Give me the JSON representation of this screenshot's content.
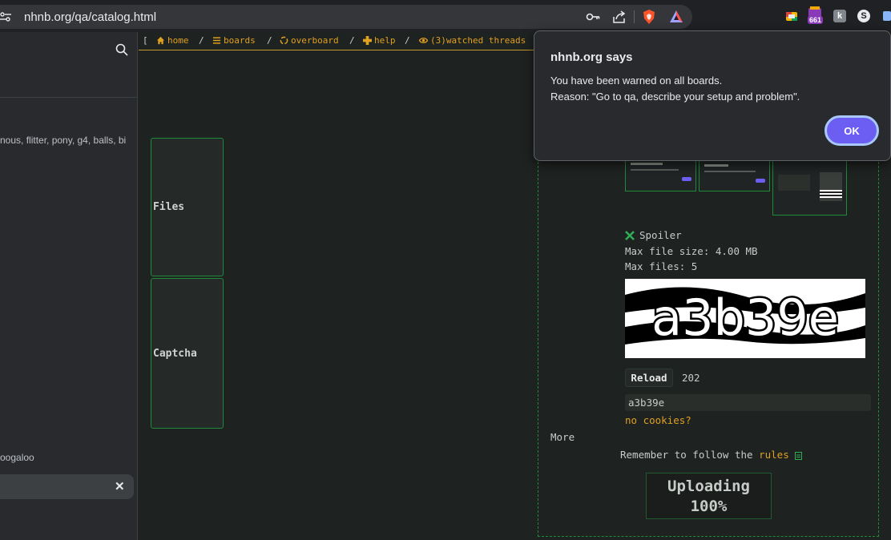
{
  "browser": {
    "url": "nhnb.org/qa/catalog.html",
    "extension_badge": "661",
    "icons": [
      "site-info-icon",
      "key-icon",
      "share-icon",
      "brave-shields-icon",
      "brave-rewards-icon",
      "ext-google-icon",
      "ext-badge-icon",
      "ext-k-icon",
      "ext-s-icon",
      "ext-partial-icon"
    ]
  },
  "side_panel": {
    "tags_text": "nous, flitter, pony, g4, balls, bi",
    "item_text": "oogaloo",
    "search_value": ""
  },
  "nav": {
    "open_bracket": "[",
    "home": "home",
    "boards": "boards",
    "overboard": "overboard",
    "help": "help",
    "watched": "(3)watched threads",
    "sep": "/"
  },
  "post_form": {
    "files_label": "Files",
    "spoiler_label": "Spoiler",
    "max_file_size": "Max file size: 4.00 MB",
    "max_files": "Max files: 5",
    "captcha_label": "Captcha",
    "captcha_text": "a3b39e",
    "reload_label": "Reload",
    "reload_timer": "202",
    "captcha_value": "a3b39e",
    "no_cookies": "no cookies?",
    "more": "More",
    "rules_prefix": "Remember to follow the ",
    "rules_link": "rules",
    "upload_line1": "Uploading",
    "upload_line2": "100%"
  },
  "dialog": {
    "title": "nhnb.org says",
    "line1": "You have been warned on all boards.",
    "line2": "Reason: \"Go to qa, describe your setup and problem\".",
    "ok": "OK"
  },
  "colors": {
    "accent_link": "#e0a020",
    "border_green": "#1f8a3a",
    "ok_button": "#6d5ef3"
  }
}
